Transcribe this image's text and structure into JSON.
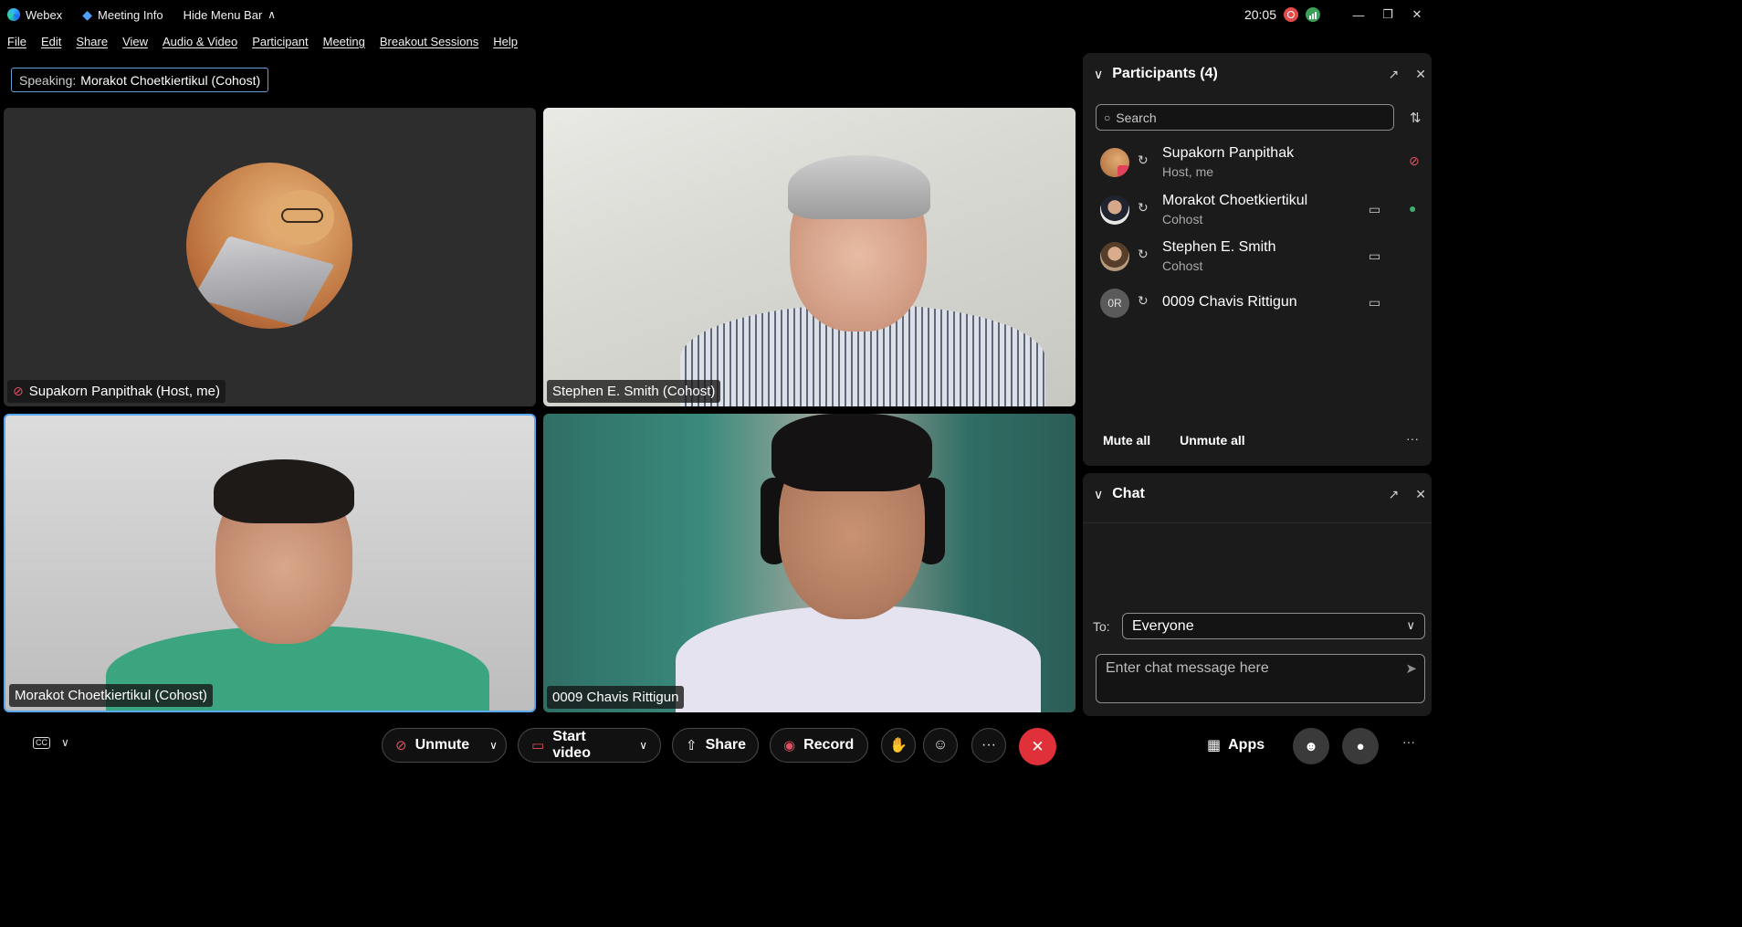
{
  "titlebar": {
    "app_name": "Webex",
    "meeting_info": "Meeting Info",
    "hide_menu": "Hide Menu Bar",
    "time": "20:05"
  },
  "menu": [
    "File",
    "Edit",
    "Share",
    "View",
    "Audio & Video",
    "Participant",
    "Meeting",
    "Breakout Sessions",
    "Help"
  ],
  "speaking": {
    "label": "Speaking:",
    "name": "Morakot Choetkiertikul (Cohost)"
  },
  "tiles": [
    {
      "name": "Supakorn Panpithak (Host, me)",
      "muted": true
    },
    {
      "name": "Stephen E. Smith (Cohost)",
      "muted": false
    },
    {
      "name": "Morakot Choetkiertikul (Cohost)",
      "muted": false,
      "active_speaker": true
    },
    {
      "name": "0009 Chavis Rittigun",
      "muted": false
    }
  ],
  "participants_panel": {
    "title": "Participants (4)",
    "search_placeholder": "Search",
    "people": [
      {
        "name": "Supakorn Panpithak",
        "role": "Host, me",
        "initials": "",
        "video": false,
        "mic": "muted"
      },
      {
        "name": "Morakot Choetkiertikul",
        "role": "Cohost",
        "initials": "",
        "video": true,
        "mic": "active"
      },
      {
        "name": "Stephen E. Smith",
        "role": "Cohost",
        "initials": "",
        "video": true,
        "mic": "none"
      },
      {
        "name": "0009 Chavis Rittigun",
        "role": "",
        "initials": "0R",
        "video": true,
        "mic": "none"
      }
    ],
    "mute_all": "Mute all",
    "unmute_all": "Unmute all"
  },
  "chat_panel": {
    "title": "Chat",
    "to_label": "To:",
    "recipient": "Everyone",
    "message_placeholder": "Enter chat message here"
  },
  "toolbar": {
    "unmute": "Unmute",
    "start_video": "Start video",
    "share": "Share",
    "record": "Record",
    "apps": "Apps"
  },
  "colors": {
    "active_speaker_border": "#5aa8f0",
    "muted_red": "#e05060",
    "end_call": "#e0303a",
    "mic_active_green": "#3db070"
  }
}
